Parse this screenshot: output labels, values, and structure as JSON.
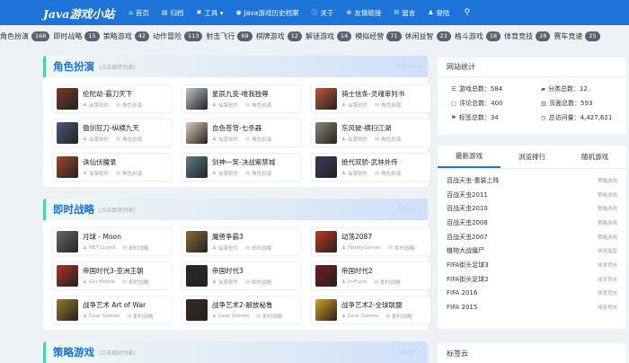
{
  "nav": {
    "brand": "Java游戏小站",
    "items": [
      {
        "icon": "⌂",
        "icon_name": "home-icon",
        "label": "首页"
      },
      {
        "icon": "▤",
        "icon_name": "archive-icon",
        "label": "归档"
      },
      {
        "icon": "✖",
        "icon_name": "tools-icon",
        "label": "工具 ▾"
      },
      {
        "icon": "◉",
        "icon_name": "history-icon",
        "label": "Java游戏历史档案"
      },
      {
        "icon": "ⓘ",
        "icon_name": "info-icon",
        "label": "关于"
      },
      {
        "icon": "⊕",
        "icon_name": "link-icon",
        "label": "友情链接"
      },
      {
        "icon": "✉",
        "icon_name": "message-icon",
        "label": "留言"
      },
      {
        "icon": "♟",
        "icon_name": "user-icon",
        "label": "登陆"
      }
    ],
    "search_icon": "⚲"
  },
  "tags": [
    {
      "label": "角色扮演",
      "count": "168"
    },
    {
      "label": "即时战略",
      "count": "15"
    },
    {
      "label": "策略游戏",
      "count": "42"
    },
    {
      "label": "动作冒险",
      "count": "113"
    },
    {
      "label": "射击飞行",
      "count": "69"
    },
    {
      "label": "棋牌游戏",
      "count": "12"
    },
    {
      "label": "解谜游戏",
      "count": "14"
    },
    {
      "label": "模拟经营",
      "count": "71"
    },
    {
      "label": "休闲益智",
      "count": "23"
    },
    {
      "label": "格斗游戏",
      "count": "18"
    },
    {
      "label": "体育竞技",
      "count": "28"
    },
    {
      "label": "赛车竞速",
      "count": "25"
    }
  ],
  "sections": [
    {
      "title": "角色扮演",
      "hint": "(点击跳转列表)",
      "more": "More",
      "games": [
        {
          "title": "伦陀劫-霸刀天下",
          "dev": "仙掌软件",
          "cat": "角色扮演",
          "color": "#7a3a22"
        },
        {
          "title": "星辰九变-唯我独尊",
          "dev": "仙掌软件",
          "cat": "角色扮演",
          "color": "#b9c4cf"
        },
        {
          "title": "骑士信条-灵魂审判书",
          "dev": "仙掌软件",
          "cat": "角色扮演",
          "color": "#c0563a"
        },
        {
          "title": "傲剑狂刀-纵横九天",
          "dev": "仙掌软件",
          "cat": "角色扮演",
          "color": "#4a5a7a"
        },
        {
          "title": "血色苍穹-七杀器",
          "dev": "仙掌软件",
          "cat": "角色扮演",
          "color": "#e2c7b8"
        },
        {
          "title": "东风破-横扫江湖",
          "dev": "仙掌软件",
          "cat": "角色扮演",
          "color": "#8c8a72"
        },
        {
          "title": "诛仙伏魔录",
          "dev": "仙掌软件",
          "cat": "角色扮演",
          "color": "#a0482c"
        },
        {
          "title": "剑神一笑-决战紫禁城",
          "dev": "仙掌软件",
          "cat": "角色扮演",
          "color": "#5e7e8c"
        },
        {
          "title": "绝代双骄-武林外传",
          "dev": "仙掌软件",
          "cat": "角色扮演",
          "color": "#3a3a5a"
        }
      ]
    },
    {
      "title": "即时战略",
      "hint": "(点击跳转列表)",
      "more": "More",
      "games": [
        {
          "title": "月球 - Moon",
          "dev": "NET Lizard",
          "cat": "即时战略",
          "color": "#6a6a6a"
        },
        {
          "title": "魔兽争霸3",
          "dev": "仙掌软件",
          "cat": "即时战略",
          "color": "#8a6a3a"
        },
        {
          "title": "动荡2087",
          "dev": "HandyGames",
          "cat": "即时战略",
          "color": "#c23a1e"
        },
        {
          "title": "帝国时代3-亚洲王朝",
          "dev": "Glu Mobile",
          "cat": "即时战略",
          "color": "#b03020"
        },
        {
          "title": "帝国时代3",
          "dev": "仙掌软件",
          "cat": "即时战略",
          "color": "#2a2a2a"
        },
        {
          "title": "帝国时代2",
          "dev": "In-Fusio",
          "cat": "即时战略",
          "color": "#7a1a1a"
        },
        {
          "title": "战争艺术 Art of War",
          "dev": "Gear Games",
          "cat": "即时战略",
          "color": "#9a7a2a"
        },
        {
          "title": "战争艺术2-解放秘鲁",
          "dev": "Gear Games",
          "cat": "即时战略",
          "color": "#3a2a1a"
        },
        {
          "title": "战争艺术2-全球联盟",
          "dev": "Gear Games",
          "cat": "即时战略",
          "color": "#d8a020"
        }
      ]
    },
    {
      "title": "策略游戏",
      "hint": "(点击跳转列表)",
      "more": "More",
      "games": []
    }
  ],
  "sidebar": {
    "stats_title": "网站统计",
    "stats": [
      {
        "icon": "☰",
        "icon_name": "list-icon",
        "label": "游戏总数：584"
      },
      {
        "icon": "▰",
        "icon_name": "folder-icon",
        "label": "分类总数：12"
      },
      {
        "icon": "▢",
        "icon_name": "comment-icon",
        "label": "评论总数：400"
      },
      {
        "icon": "▥",
        "icon_name": "page-icon",
        "label": "页面总数：593"
      },
      {
        "icon": "⚑",
        "icon_name": "tag-icon",
        "label": "标签总数：34"
      },
      {
        "icon": "◷",
        "icon_name": "clock-icon",
        "label": "总访问量：4,427,621"
      }
    ],
    "tabs": [
      "最新游戏",
      "浏览排行",
      "随机游戏"
    ],
    "latest": [
      {
        "name": "百战天虫-重装上阵",
        "cat": "策略游戏"
      },
      {
        "name": "百战天虫2011",
        "cat": "策略游戏"
      },
      {
        "name": "百战天虫2010",
        "cat": "策略游戏"
      },
      {
        "name": "百战天虫2008",
        "cat": "策略游戏"
      },
      {
        "name": "百战天虫2007",
        "cat": "策略游戏"
      },
      {
        "name": "植物大战僵尸",
        "cat": "休闲益智"
      },
      {
        "name": "FIFA街头足球3",
        "cat": "体育竞技"
      },
      {
        "name": "FIFA街头足球2",
        "cat": "体育竞技"
      },
      {
        "name": "FIFA 2016",
        "cat": "体育竞技"
      },
      {
        "name": "FIFA 2015",
        "cat": "体育竞技"
      }
    ],
    "cloud_title": "标签云"
  },
  "colors": {
    "primary": "#1e73d8",
    "accent": "#4bd0a8",
    "badge": "#5a6270"
  }
}
